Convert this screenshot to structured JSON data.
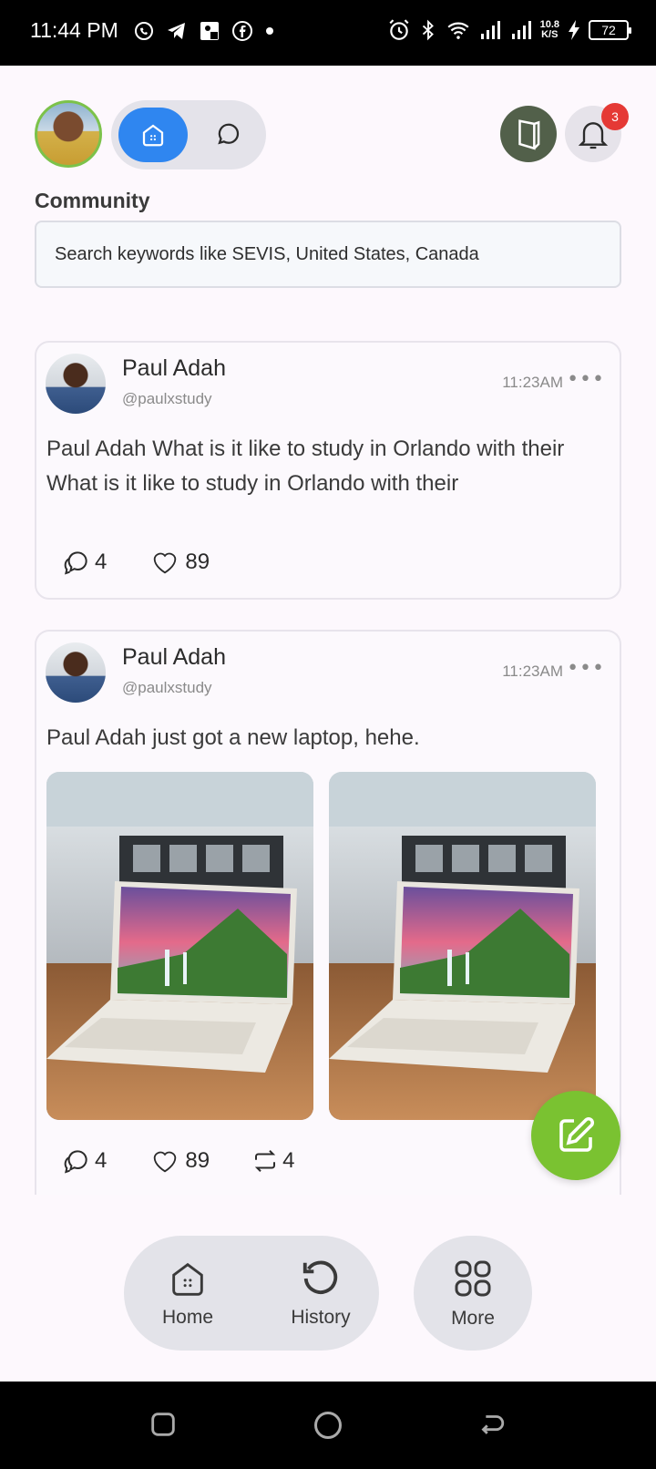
{
  "status_bar": {
    "time": "11:44 PM",
    "net_speed_value": "10.8",
    "net_speed_unit": "K/S",
    "battery": "72"
  },
  "header": {
    "notification_count": "3",
    "community_title": "Community",
    "search_placeholder": "Search keywords like SEVIS, United States, Canada"
  },
  "posts": [
    {
      "name": "Paul Adah",
      "handle": "@paulxstudy",
      "time": "11:23AM",
      "more": "•••",
      "text": "Paul Adah What is it like to study in Orlando with their What is it like to study in Orlando with their",
      "comments": "4",
      "likes": "89"
    },
    {
      "name": "Paul Adah",
      "handle": "@paulxstudy",
      "time": "11:23AM",
      "more": "•••",
      "text": "Paul Adah just got a new laptop, hehe.",
      "comments": "4",
      "likes": "89",
      "reposts": "4"
    }
  ],
  "bottom_nav": {
    "home": "Home",
    "history": "History",
    "more": "More"
  },
  "colors": {
    "accent_blue": "#2f86f0",
    "fab_green": "#7ac231",
    "badge_red": "#e53935"
  }
}
